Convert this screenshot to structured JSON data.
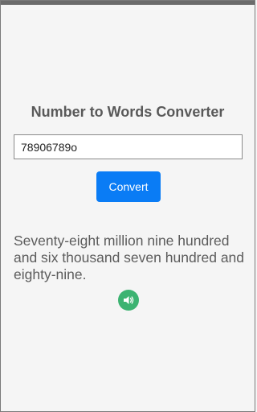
{
  "app": {
    "title": "Number to Words Converter"
  },
  "input": {
    "value": "78906789o"
  },
  "convert_button": {
    "label": "Convert"
  },
  "result": {
    "text": "Seventy-eight million nine hundred and six thousand seven hundred and eighty-nine."
  },
  "speaker": {
    "icon": "speaker-icon"
  },
  "colors": {
    "accent": "#0a7cf5",
    "speaker": "#3cb371",
    "title": "#595959"
  }
}
